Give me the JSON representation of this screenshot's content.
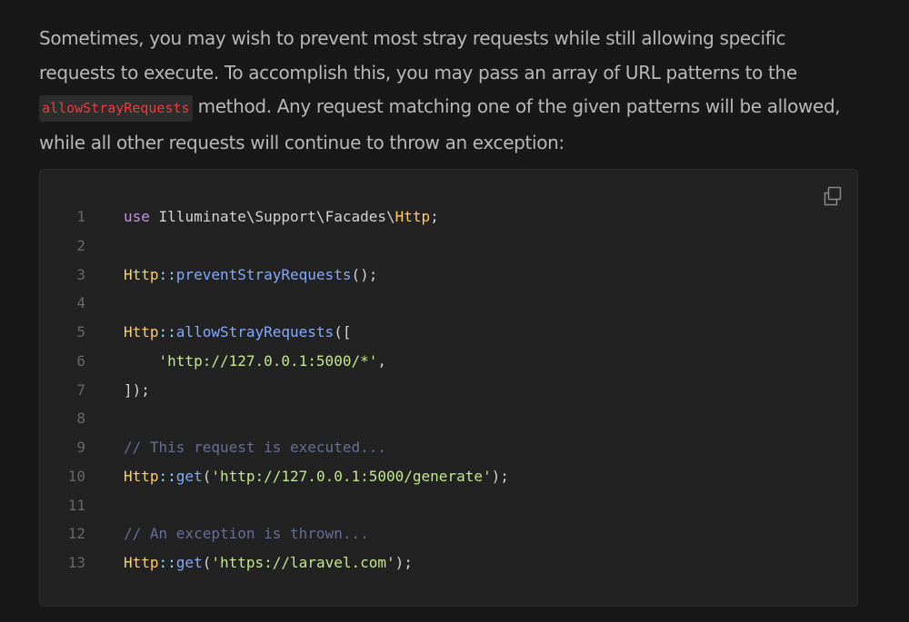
{
  "paragraph": {
    "before_code": "Sometimes, you may wish to prevent most stray requests while still allowing specific requests to execute. To accomplish this, you may pass an array of URL patterns to the",
    "inline_code": "allowStrayRequests",
    "after_code": "method. Any request matching one of the given patterns will be allowed, while all other requests will continue to throw an exception:"
  },
  "code_block": {
    "copy_icon": "copy-icon",
    "colors": {
      "keyword": "#c792ea",
      "class": "#ffcb6b",
      "operator": "#89ddff",
      "function": "#82aaff",
      "string": "#c3e88d",
      "comment": "#676e95",
      "inline_code": "#ef3b3b"
    },
    "lines": [
      {
        "num": "1",
        "tokens": [
          {
            "t": "use",
            "c": "kw"
          },
          {
            "t": " Illuminate\\Support\\Facades\\",
            "c": "pl"
          },
          {
            "t": "Http",
            "c": "cls"
          },
          {
            "t": ";",
            "c": "pl"
          }
        ]
      },
      {
        "num": "2",
        "tokens": []
      },
      {
        "num": "3",
        "tokens": [
          {
            "t": "Http",
            "c": "cls"
          },
          {
            "t": "::",
            "c": "op"
          },
          {
            "t": "preventStrayRequests",
            "c": "fn"
          },
          {
            "t": "();",
            "c": "pl"
          }
        ]
      },
      {
        "num": "4",
        "tokens": []
      },
      {
        "num": "5",
        "tokens": [
          {
            "t": "Http",
            "c": "cls"
          },
          {
            "t": "::",
            "c": "op"
          },
          {
            "t": "allowStrayRequests",
            "c": "fn"
          },
          {
            "t": "([",
            "c": "pl"
          }
        ]
      },
      {
        "num": "6",
        "tokens": [
          {
            "t": "    ",
            "c": "pl"
          },
          {
            "t": "'http://127.0.0.1:5000/*'",
            "c": "str"
          },
          {
            "t": ",",
            "c": "pl"
          }
        ]
      },
      {
        "num": "7",
        "tokens": [
          {
            "t": "]);",
            "c": "pl"
          }
        ]
      },
      {
        "num": "8",
        "tokens": []
      },
      {
        "num": "9",
        "tokens": [
          {
            "t": "// This request is executed...",
            "c": "cm"
          }
        ]
      },
      {
        "num": "10",
        "tokens": [
          {
            "t": "Http",
            "c": "cls"
          },
          {
            "t": "::",
            "c": "op"
          },
          {
            "t": "get",
            "c": "fn"
          },
          {
            "t": "(",
            "c": "pl"
          },
          {
            "t": "'http://127.0.0.1:5000/generate'",
            "c": "str"
          },
          {
            "t": ");",
            "c": "pl"
          }
        ]
      },
      {
        "num": "11",
        "tokens": []
      },
      {
        "num": "12",
        "tokens": [
          {
            "t": "// An exception is thrown...",
            "c": "cm"
          }
        ]
      },
      {
        "num": "13",
        "tokens": [
          {
            "t": "Http",
            "c": "cls"
          },
          {
            "t": "::",
            "c": "op"
          },
          {
            "t": "get",
            "c": "fn"
          },
          {
            "t": "(",
            "c": "pl"
          },
          {
            "t": "'https://laravel.com'",
            "c": "str"
          },
          {
            "t": ");",
            "c": "pl"
          }
        ]
      }
    ]
  }
}
